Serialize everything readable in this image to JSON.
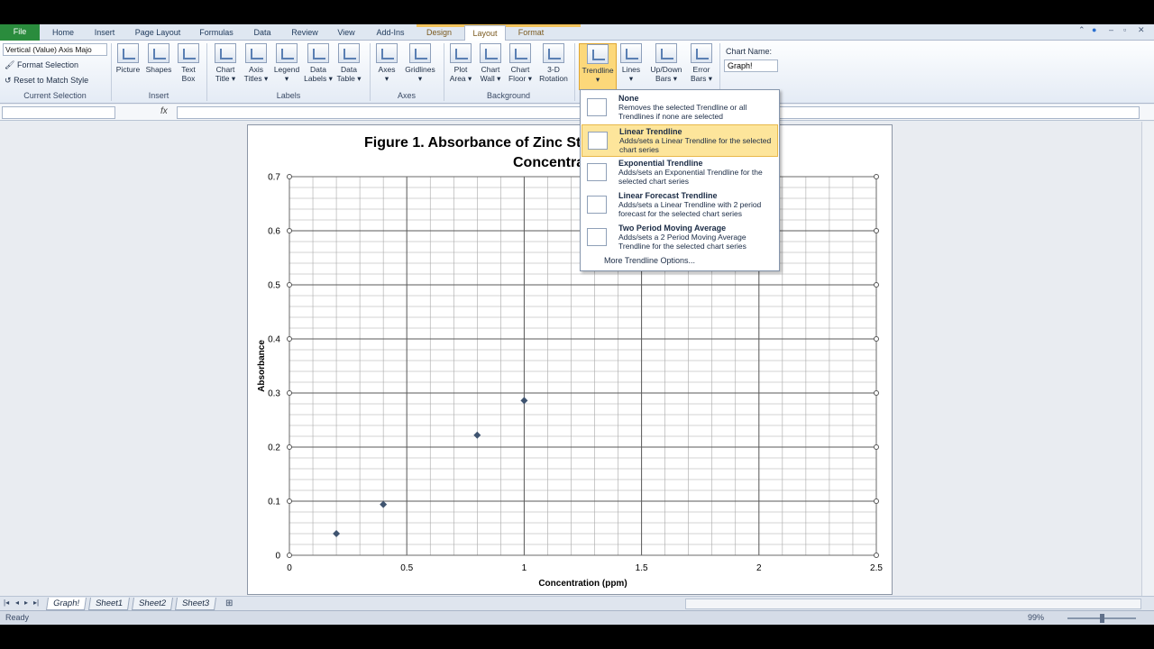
{
  "tabs": [
    "File",
    "Home",
    "Insert",
    "Page Layout",
    "Formulas",
    "Data",
    "Review",
    "View",
    "Add-Ins",
    "Design",
    "Layout",
    "Format"
  ],
  "active_tab": "Layout",
  "ribbon": {
    "current_selection": {
      "combo_value": "Vertical (Value) Axis Majo",
      "format_selection": "Format Selection",
      "reset_style": "Reset to Match Style",
      "label": "Current Selection"
    },
    "insert": {
      "picture": "Picture",
      "shapes": "Shapes",
      "text_box_1": "Text",
      "text_box_2": "Box",
      "label": "Insert"
    },
    "labels": {
      "chart_title_1": "Chart",
      "chart_title_2": "Title",
      "axis_titles_1": "Axis",
      "axis_titles_2": "Titles",
      "legend": "Legend",
      "data_labels_1": "Data",
      "data_labels_2": "Labels",
      "data_table_1": "Data",
      "data_table_2": "Table",
      "label": "Labels"
    },
    "axes": {
      "axes": "Axes",
      "gridlines": "Gridlines",
      "label": "Axes"
    },
    "background": {
      "plot_area_1": "Plot",
      "plot_area_2": "Area",
      "chart_wall_1": "Chart",
      "chart_wall_2": "Wall",
      "chart_floor_1": "Chart",
      "chart_floor_2": "Floor",
      "rotation_1": "3-D",
      "rotation_2": "Rotation",
      "label": "Background"
    },
    "analysis": {
      "trendline": "Trendline",
      "lines": "Lines",
      "updown_1": "Up/Down",
      "updown_2": "Bars",
      "error_1": "Error",
      "error_2": "Bars"
    },
    "properties": {
      "chart_name_label": "Chart Name:",
      "chart_name_value": "Graph!"
    }
  },
  "trendline_menu": {
    "items": [
      {
        "title": "None",
        "desc": "Removes the selected Trendline or all Trendlines if none are selected"
      },
      {
        "title": "Linear Trendline",
        "desc": "Adds/sets a Linear Trendline for the selected chart series"
      },
      {
        "title": "Exponential Trendline",
        "desc": "Adds/sets an Exponential Trendline for the selected chart series"
      },
      {
        "title": "Linear Forecast Trendline",
        "desc": "Adds/sets a Linear Trendline with 2 period forecast for the selected chart series"
      },
      {
        "title": "Two Period Moving Average",
        "desc": "Adds/sets a 2 Period Moving Average Trendline for the selected chart series"
      }
    ],
    "highlighted_index": 1,
    "more_options": "More Trendline Options..."
  },
  "sheet_tabs": [
    "Graph!",
    "Sheet1",
    "Sheet2",
    "Sheet3"
  ],
  "active_sheet": "Graph!",
  "status": {
    "ready": "Ready",
    "zoom": "99%"
  },
  "chart_data": {
    "type": "scatter",
    "title_line1": "Figure 1. Absorbance of Zinc St",
    "title_line2": "Concentra",
    "xlabel": "Concentration (ppm)",
    "ylabel": "Absorbance",
    "xlim": [
      0,
      2.5
    ],
    "ylim": [
      0,
      0.7
    ],
    "x_ticks": [
      0,
      0.5,
      1,
      1.5,
      2,
      2.5
    ],
    "x_tick_labels": [
      "0",
      "0.5",
      "1",
      "1.5",
      "2",
      "2.5"
    ],
    "y_ticks": [
      0,
      0.1,
      0.2,
      0.3,
      0.4,
      0.5,
      0.6,
      0.7
    ],
    "y_tick_labels": [
      "0",
      "0.1",
      "0.2",
      "0.3",
      "0.4",
      "0.5",
      "0.6",
      "0.7"
    ],
    "grid": true,
    "series": [
      {
        "x": [
          0.2,
          0.4,
          0.8,
          1.0
        ],
        "y": [
          0.04,
          0.094,
          0.222,
          0.286
        ],
        "color": "#3f5470"
      }
    ]
  }
}
